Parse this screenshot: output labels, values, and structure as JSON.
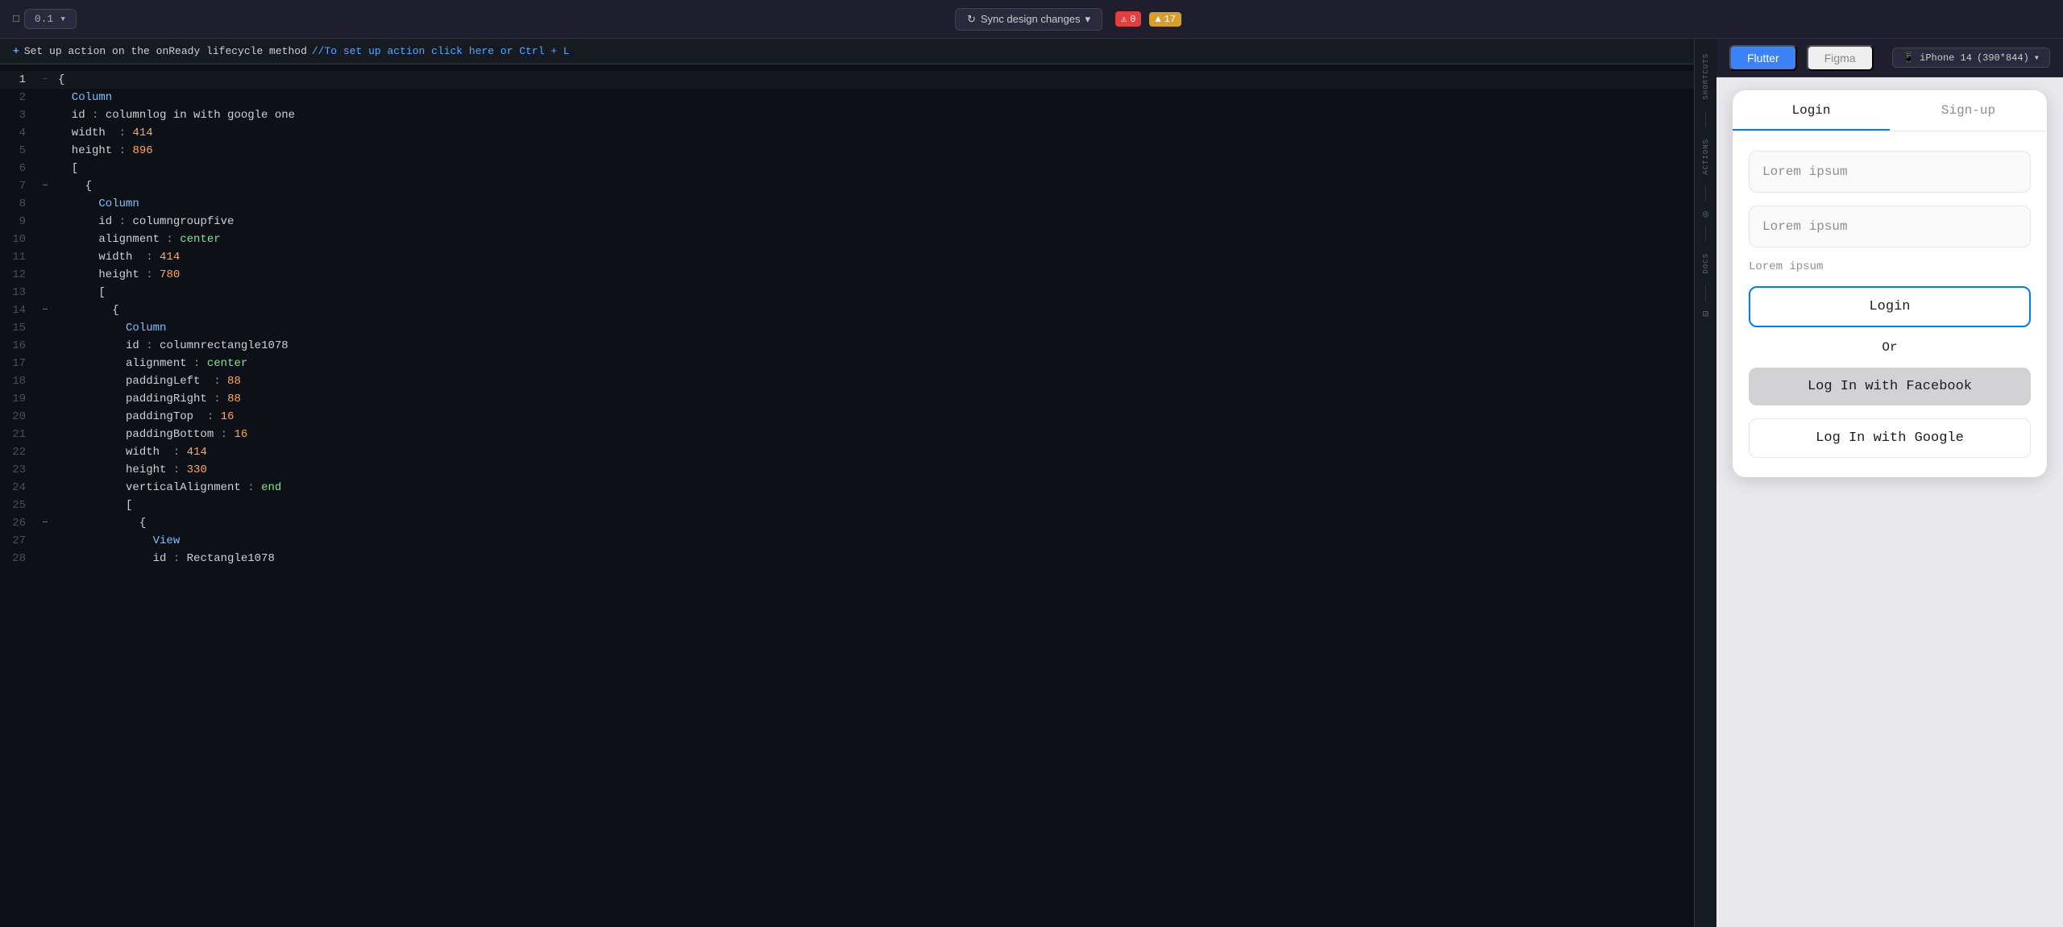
{
  "toolbar": {
    "logo_icon": "□",
    "version": "0.1",
    "chevron": "▾",
    "sync_label": "Sync design changes",
    "sync_chevron": "▾",
    "errors": "0",
    "warnings": "17",
    "error_icon": "⚠",
    "warning_icon": "▲"
  },
  "action_bar": {
    "plus": "+",
    "label": "Set up action on the onReady lifecycle method",
    "comment": "//To set up action click here or Ctrl + L"
  },
  "code": {
    "lines": [
      {
        "num": "1",
        "content": "{",
        "fold": "—",
        "indent": 0,
        "active": true
      },
      {
        "num": "2",
        "indent": 1,
        "parts": [
          {
            "text": "Column",
            "cls": "kw-blue"
          }
        ]
      },
      {
        "num": "3",
        "indent": 1,
        "parts": [
          {
            "text": "id",
            "cls": "kw-white"
          },
          {
            "text": " : ",
            "cls": "kw-gray"
          },
          {
            "text": "columnlog in with google one",
            "cls": "kw-white"
          }
        ]
      },
      {
        "num": "4",
        "indent": 1,
        "parts": [
          {
            "text": "width",
            "cls": "kw-white"
          },
          {
            "text": "  : ",
            "cls": "kw-gray"
          },
          {
            "text": "414",
            "cls": "kw-orange"
          }
        ]
      },
      {
        "num": "5",
        "indent": 1,
        "parts": [
          {
            "text": "height",
            "cls": "kw-white"
          },
          {
            "text": " : ",
            "cls": "kw-gray"
          },
          {
            "text": "896",
            "cls": "kw-orange"
          }
        ]
      },
      {
        "num": "6",
        "indent": 1,
        "parts": [
          {
            "text": "[",
            "cls": "kw-white"
          }
        ]
      },
      {
        "num": "7",
        "indent": 2,
        "parts": [
          {
            "text": "{",
            "cls": "kw-white"
          }
        ],
        "fold": "—"
      },
      {
        "num": "8",
        "indent": 3,
        "parts": [
          {
            "text": "Column",
            "cls": "kw-blue"
          }
        ]
      },
      {
        "num": "9",
        "indent": 3,
        "parts": [
          {
            "text": "id",
            "cls": "kw-white"
          },
          {
            "text": " : ",
            "cls": "kw-gray"
          },
          {
            "text": "columngroupfive",
            "cls": "kw-white"
          }
        ]
      },
      {
        "num": "10",
        "indent": 3,
        "parts": [
          {
            "text": "alignment",
            "cls": "kw-white"
          },
          {
            "text": " : ",
            "cls": "kw-gray"
          },
          {
            "text": "center",
            "cls": "kw-green"
          }
        ]
      },
      {
        "num": "11",
        "indent": 3,
        "parts": [
          {
            "text": "width",
            "cls": "kw-white"
          },
          {
            "text": "  : ",
            "cls": "kw-gray"
          },
          {
            "text": "414",
            "cls": "kw-orange"
          }
        ]
      },
      {
        "num": "12",
        "indent": 3,
        "parts": [
          {
            "text": "height",
            "cls": "kw-white"
          },
          {
            "text": " : ",
            "cls": "kw-gray"
          },
          {
            "text": "780",
            "cls": "kw-orange"
          }
        ]
      },
      {
        "num": "13",
        "indent": 3,
        "parts": [
          {
            "text": "[",
            "cls": "kw-white"
          }
        ]
      },
      {
        "num": "14",
        "indent": 4,
        "parts": [
          {
            "text": "{",
            "cls": "kw-white"
          }
        ],
        "fold": "—"
      },
      {
        "num": "15",
        "indent": 5,
        "parts": [
          {
            "text": "Column",
            "cls": "kw-blue"
          }
        ]
      },
      {
        "num": "16",
        "indent": 5,
        "parts": [
          {
            "text": "id",
            "cls": "kw-white"
          },
          {
            "text": " : ",
            "cls": "kw-gray"
          },
          {
            "text": "columnrectangle1078",
            "cls": "kw-white"
          }
        ]
      },
      {
        "num": "17",
        "indent": 5,
        "parts": [
          {
            "text": "alignment",
            "cls": "kw-white"
          },
          {
            "text": " : ",
            "cls": "kw-gray"
          },
          {
            "text": "center",
            "cls": "kw-green"
          }
        ]
      },
      {
        "num": "18",
        "indent": 5,
        "parts": [
          {
            "text": "paddingLeft",
            "cls": "kw-white"
          },
          {
            "text": "  : ",
            "cls": "kw-gray"
          },
          {
            "text": "88",
            "cls": "kw-orange"
          }
        ]
      },
      {
        "num": "19",
        "indent": 5,
        "parts": [
          {
            "text": "paddingRight",
            "cls": "kw-white"
          },
          {
            "text": " : ",
            "cls": "kw-gray"
          },
          {
            "text": "88",
            "cls": "kw-orange"
          }
        ]
      },
      {
        "num": "20",
        "indent": 5,
        "parts": [
          {
            "text": "paddingTop",
            "cls": "kw-white"
          },
          {
            "text": "  : ",
            "cls": "kw-gray"
          },
          {
            "text": "16",
            "cls": "kw-orange"
          }
        ]
      },
      {
        "num": "21",
        "indent": 5,
        "parts": [
          {
            "text": "paddingBottom",
            "cls": "kw-white"
          },
          {
            "text": " : ",
            "cls": "kw-gray"
          },
          {
            "text": "16",
            "cls": "kw-orange"
          }
        ]
      },
      {
        "num": "22",
        "indent": 5,
        "parts": [
          {
            "text": "width",
            "cls": "kw-white"
          },
          {
            "text": "  : ",
            "cls": "kw-gray"
          },
          {
            "text": "414",
            "cls": "kw-orange"
          }
        ]
      },
      {
        "num": "23",
        "indent": 5,
        "parts": [
          {
            "text": "height",
            "cls": "kw-white"
          },
          {
            "text": " : ",
            "cls": "kw-gray"
          },
          {
            "text": "330",
            "cls": "kw-orange"
          }
        ]
      },
      {
        "num": "24",
        "indent": 5,
        "parts": [
          {
            "text": "verticalAlignment",
            "cls": "kw-white"
          },
          {
            "text": " : ",
            "cls": "kw-gray"
          },
          {
            "text": "end",
            "cls": "kw-green"
          }
        ]
      },
      {
        "num": "25",
        "indent": 5,
        "parts": [
          {
            "text": "[",
            "cls": "kw-white"
          }
        ]
      },
      {
        "num": "26",
        "indent": 6,
        "parts": [
          {
            "text": "{",
            "cls": "kw-white"
          }
        ],
        "fold": "—"
      },
      {
        "num": "27",
        "indent": 7,
        "parts": [
          {
            "text": "View",
            "cls": "kw-blue"
          }
        ]
      },
      {
        "num": "28",
        "indent": 7,
        "parts": [
          {
            "text": "id",
            "cls": "kw-white"
          },
          {
            "text": " : ",
            "cls": "kw-gray"
          },
          {
            "text": "Rectangle1078",
            "cls": "kw-white"
          }
        ]
      }
    ]
  },
  "shortcuts": {
    "label": "SHORTCUTS",
    "actions_label": "ACTIONS",
    "docs_label": "DOCS",
    "grid_icon": "⊞",
    "target_icon": "◎",
    "book_icon": "📖",
    "grid2_icon": "⊡"
  },
  "preview": {
    "flutter_tab": "Flutter",
    "figma_tab": "Figma",
    "device_label": "iPhone 14",
    "device_dims": "(390*844)",
    "chevron": "▾",
    "device_icon": "📱"
  },
  "app": {
    "tabs": [
      {
        "label": "Login",
        "active": true
      },
      {
        "label": "Sign-up",
        "active": false
      }
    ],
    "input1_placeholder": "Lorem ipsum",
    "input2_placeholder": "Lorem ipsum",
    "forgot_label": "Lorem ipsum",
    "login_btn": "Login",
    "or_label": "Or",
    "facebook_btn": "Log In with Facebook",
    "google_btn": "Log In with Google",
    "cursor_visible": true
  }
}
